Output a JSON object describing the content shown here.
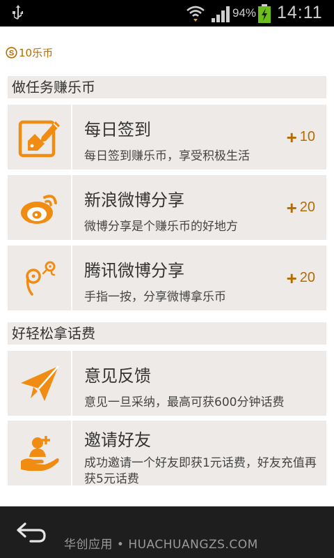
{
  "status_bar": {
    "battery_percent": "94%",
    "time": "14:11",
    "icons": [
      "usb-icon",
      "wifi-icon",
      "signal-icon",
      "battery-charging-icon"
    ]
  },
  "balance": {
    "label": "10乐币",
    "icon": "coin-icon"
  },
  "sections": {
    "earn": {
      "title": "做任务赚乐币",
      "items": [
        {
          "title": "每日签到",
          "desc": "每日签到赚乐币，享受积极生活",
          "reward": "10",
          "icon": "checkin-icon"
        },
        {
          "title": "新浪微博分享",
          "desc": "微博分享是个赚乐币的好地方",
          "reward": "20",
          "icon": "weibo-icon"
        },
        {
          "title": "腾讯微博分享",
          "desc": "手指一按，分享微博拿乐币",
          "reward": "20",
          "icon": "tencent-weibo-icon"
        }
      ]
    },
    "phone_credit": {
      "title": "好轻松拿话费",
      "items": [
        {
          "title": "意见反馈",
          "desc": "意见一旦采纳，最高可获600分钟话费",
          "icon": "paper-plane-icon"
        },
        {
          "title": "邀请好友",
          "desc": "成功邀请一个好友即获1元话费，好友充值再获5元话费",
          "icon": "invite-friend-icon"
        }
      ]
    }
  },
  "bottom_bar": {
    "watermark": "华创应用 • HUACHUANGZS.COM",
    "icon": "back-icon"
  },
  "colors": {
    "accent": "#f08c12",
    "reward_text": "#b56b00",
    "card_bg": "#eeeae7"
  }
}
